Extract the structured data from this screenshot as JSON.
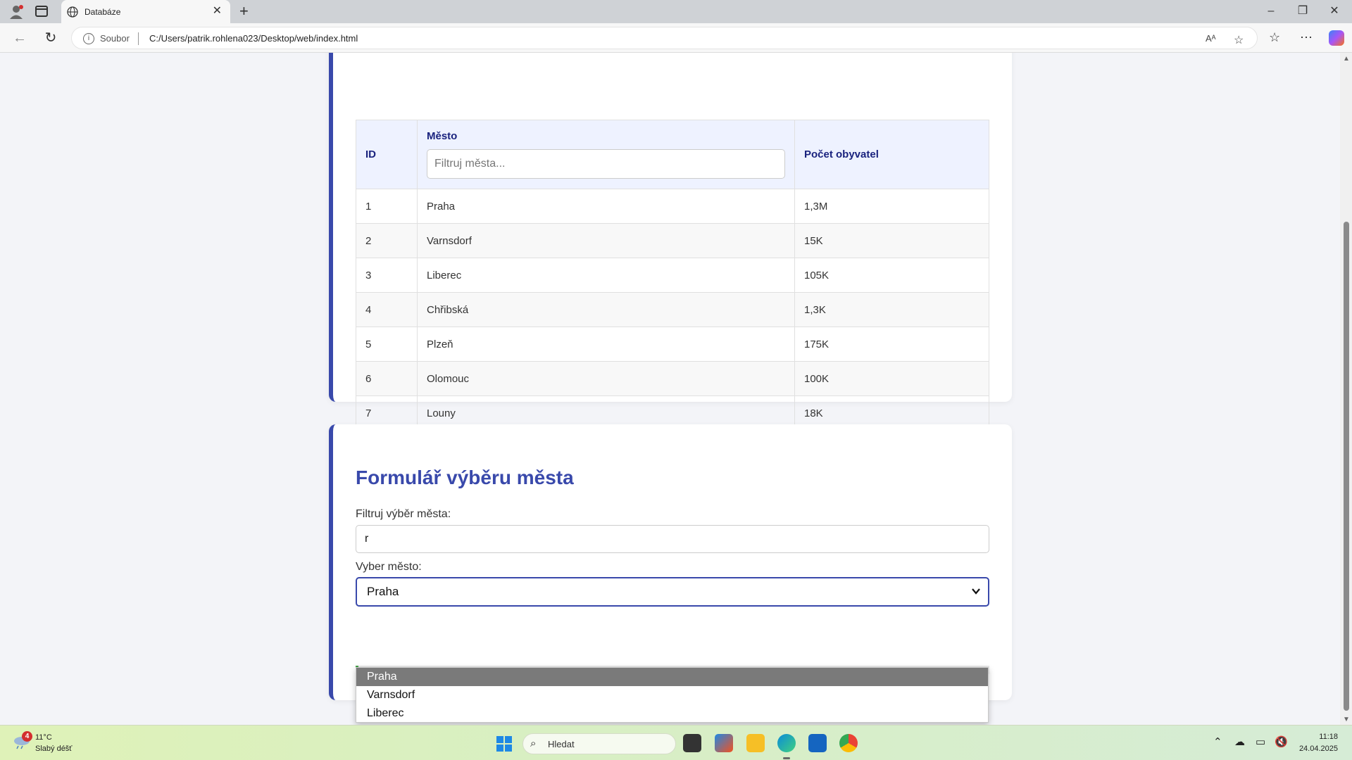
{
  "browser": {
    "tab_title": "Databáze",
    "tab_close": "✕",
    "new_tab": "+",
    "address_scheme": "Soubor",
    "address_url": "C:/Users/patrik.rohlena023/Desktop/web/index.html"
  },
  "city_table": {
    "headers": {
      "id": "ID",
      "city": "Město",
      "population": "Počet obyvatel"
    },
    "city_filter_placeholder": "Filtruj města...",
    "rows": [
      {
        "id": "1",
        "city": "Praha",
        "population": "1,3M"
      },
      {
        "id": "2",
        "city": "Varnsdorf",
        "population": "15K"
      },
      {
        "id": "3",
        "city": "Liberec",
        "population": "105K"
      },
      {
        "id": "4",
        "city": "Chřibská",
        "population": "1,3K"
      },
      {
        "id": "5",
        "city": "Plzeň",
        "population": "175K"
      },
      {
        "id": "6",
        "city": "Olomouc",
        "population": "100K"
      },
      {
        "id": "7",
        "city": "Louny",
        "population": "18K"
      }
    ]
  },
  "city_form": {
    "title": "Formulář výběru města",
    "filter_label": "Filtruj výběr města:",
    "filter_value": "r",
    "select_label": "Vyber město:",
    "select_value": "Praha",
    "options": [
      "Praha",
      "Varnsdorf",
      "Liberec"
    ],
    "selected_option_index": 0
  },
  "taskbar": {
    "weather_temp": "11°C",
    "weather_desc": "Slabý déšť",
    "weather_badge": "4",
    "search_placeholder": "Hledat",
    "time": "11:18",
    "date": "24.04.2025"
  },
  "colors": {
    "accent": "#3949ab",
    "header_text": "#1a237e",
    "submit_accent": "#43a047"
  }
}
